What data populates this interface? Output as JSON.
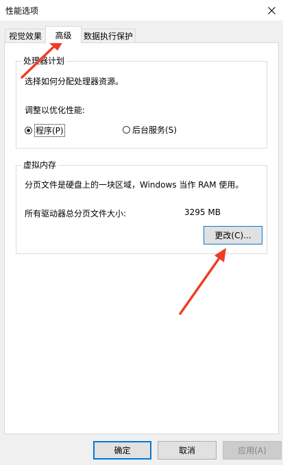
{
  "window": {
    "title": "性能选项",
    "close_label": "close"
  },
  "tabs": [
    {
      "label": "视觉效果"
    },
    {
      "label": "高级"
    },
    {
      "label": "数据执行保护"
    }
  ],
  "processor": {
    "group_title": "处理器计划",
    "description": "选择如何分配处理器资源。",
    "adjust_label": "调整以优化性能:",
    "options": [
      {
        "label": "程序(P)",
        "checked": true
      },
      {
        "label": "后台服务(S)",
        "checked": false
      }
    ]
  },
  "virtual_memory": {
    "group_title": "虚拟内存",
    "description": "分页文件是硬盘上的一块区域，Windows 当作 RAM 使用。",
    "total_label": "所有驱动器总分页文件大小:",
    "total_value": "3295 MB",
    "change_button": "更改(C)..."
  },
  "footer": {
    "ok": "确定",
    "cancel": "取消",
    "apply": "应用(A)"
  },
  "annotation_color": "#f03c24"
}
